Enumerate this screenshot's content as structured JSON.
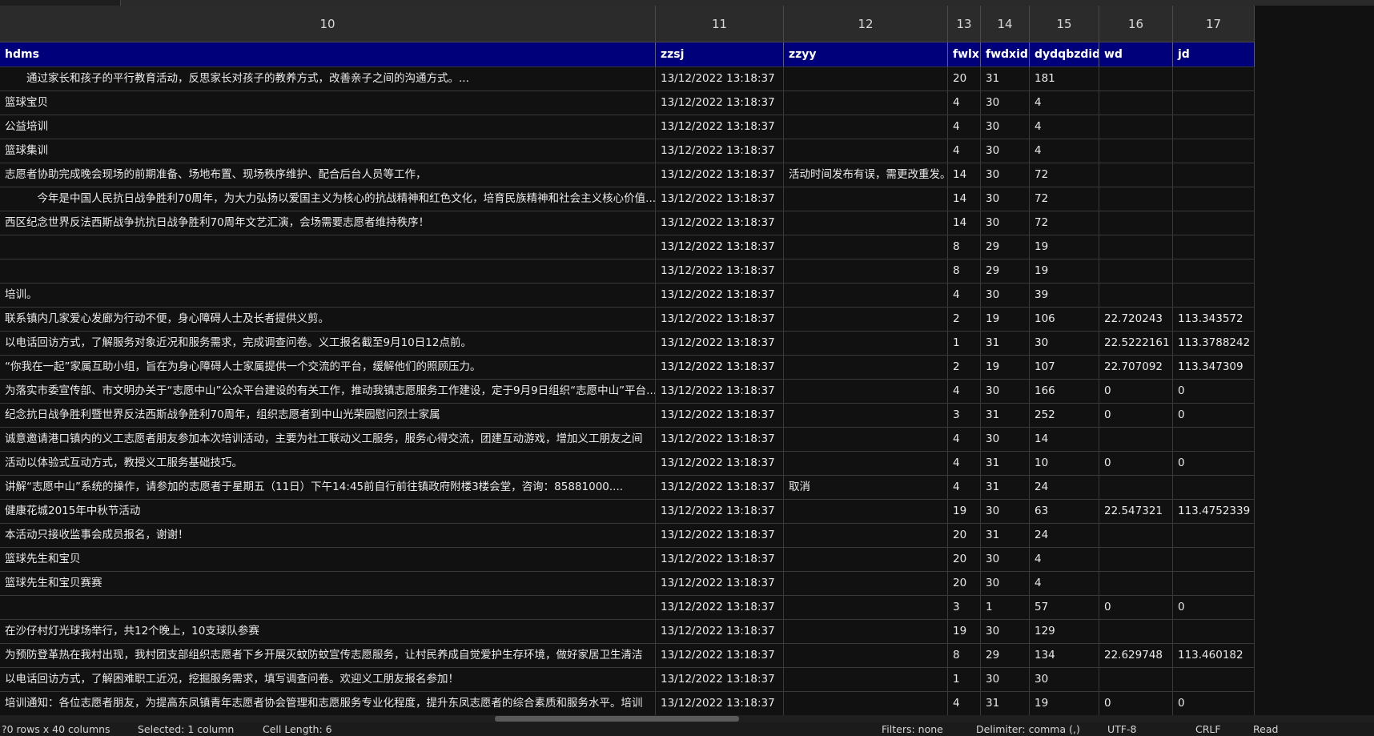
{
  "column_numbers": [
    "10",
    "11",
    "12",
    "13",
    "14",
    "15",
    "16",
    "17"
  ],
  "headers": [
    "hdms",
    "zzsj",
    "zzyy",
    "fwlx",
    "fwdxid",
    "dydqbzdid",
    "wd",
    "jd"
  ],
  "rows": [
    [
      "　　通过家长和孩子的平行教育活动，反思家长对孩子的教养方式，改善亲子之间的沟通方式。...",
      "13/12/2022 13:18:37",
      "",
      "20",
      "31",
      "181",
      "",
      ""
    ],
    [
      "篮球宝贝",
      "13/12/2022 13:18:37",
      "",
      "4",
      "30",
      "4",
      "",
      ""
    ],
    [
      "公益培训",
      "13/12/2022 13:18:37",
      "",
      "4",
      "30",
      "4",
      "",
      ""
    ],
    [
      "篮球集训",
      "13/12/2022 13:18:37",
      "",
      "4",
      "30",
      "4",
      "",
      ""
    ],
    [
      "志愿者协助完成晚会现场的前期准备、场地布置、现场秩序维护、配合后台人员等工作，",
      "13/12/2022 13:18:37",
      "活动时间发布有误，需更改重发。",
      "14",
      "30",
      "72",
      "",
      ""
    ],
    [
      "　　　今年是中国人民抗日战争胜利70周年，为大力弘扬以爱国主义为核心的抗战精神和红色文化，培育民族精神和社会主义核心价值...",
      "13/12/2022 13:18:37",
      "",
      "14",
      "30",
      "72",
      "",
      ""
    ],
    [
      "西区纪念世界反法西斯战争抗抗日战争胜利70周年文艺汇演，会场需要志愿者维持秩序！",
      "13/12/2022 13:18:37",
      "",
      "14",
      "30",
      "72",
      "",
      ""
    ],
    [
      "",
      "13/12/2022 13:18:37",
      "",
      "8",
      "29",
      "19",
      "",
      ""
    ],
    [
      "",
      "13/12/2022 13:18:37",
      "",
      "8",
      "29",
      "19",
      "",
      ""
    ],
    [
      "培训。",
      "13/12/2022 13:18:37",
      "",
      "4",
      "30",
      "39",
      "",
      ""
    ],
    [
      "联系镇内几家爱心发廊为行动不便，身心障碍人士及长者提供义剪。",
      "13/12/2022 13:18:37",
      "",
      "2",
      "19",
      "106",
      "22.720243",
      "113.343572"
    ],
    [
      "以电话回访方式，了解服务对象近况和服务需求，完成调查问卷。义工报名截至9月10日12点前。",
      "13/12/2022 13:18:37",
      "",
      "1",
      "31",
      "30",
      "22.5222161",
      "113.3788242"
    ],
    [
      "“你我在一起”家属互助小组，旨在为身心障碍人士家属提供一个交流的平台，缓解他们的照顾压力。",
      "13/12/2022 13:18:37",
      "",
      "2",
      "19",
      "107",
      "22.707092",
      "113.347309"
    ],
    [
      "为落实市委宣传部、市文明办关于“志愿中山”公众平台建设的有关工作，推动我镇志愿服务工作建设，定于9月9日组织“志愿中山”平台...",
      "13/12/2022 13:18:37",
      "",
      "4",
      "30",
      "166",
      "0",
      "0"
    ],
    [
      "纪念抗日战争胜利暨世界反法西斯战争胜利70周年，组织志愿者到中山光荣园慰问烈士家属",
      "13/12/2022 13:18:37",
      "",
      "3",
      "31",
      "252",
      "0",
      "0"
    ],
    [
      "诚意邀请港口镇内的义工志愿者朋友参加本次培训活动，主要为社工联动义工服务，服务心得交流，团建互动游戏，增加义工朋友之间",
      "13/12/2022 13:18:37",
      "",
      "4",
      "30",
      "14",
      "",
      ""
    ],
    [
      "活动以体验式互动方式，教授义工服务基础技巧。",
      "13/12/2022 13:18:37",
      "",
      "4",
      "31",
      "10",
      "0",
      "0"
    ],
    [
      "讲解“志愿中山”系统的操作，请参加的志愿者于星期五（11日）下午14:45前自行前往镇政府附楼3楼会堂，咨询：85881000....",
      "13/12/2022 13:18:37",
      "取消",
      "4",
      "31",
      "24",
      "",
      ""
    ],
    [
      "健康花城2015年中秋节活动",
      "13/12/2022 13:18:37",
      "",
      "19",
      "30",
      "63",
      "22.547321",
      "113.4752339"
    ],
    [
      "本活动只接收监事会成员报名，谢谢！",
      "13/12/2022 13:18:37",
      "",
      "20",
      "31",
      "24",
      "",
      ""
    ],
    [
      "篮球先生和宝贝",
      "13/12/2022 13:18:37",
      "",
      "20",
      "30",
      "4",
      "",
      ""
    ],
    [
      "篮球先生和宝贝赛赛",
      "13/12/2022 13:18:37",
      "",
      "20",
      "30",
      "4",
      "",
      ""
    ],
    [
      "",
      "13/12/2022 13:18:37",
      "",
      "3",
      "1",
      "57",
      "0",
      "0"
    ],
    [
      "在沙仔村灯光球场举行，共12个晚上，10支球队参赛",
      "13/12/2022 13:18:37",
      "",
      "19",
      "30",
      "129",
      "",
      ""
    ],
    [
      "为预防登革热在我村出现，我村团支部组织志愿者下乡开展灭蚊防蚊宣传志愿服务，让村民养成自觉爱护生存环境，做好家居卫生清洁",
      "13/12/2022 13:18:37",
      "",
      "8",
      "29",
      "134",
      "22.629748",
      "113.460182"
    ],
    [
      "以电话回访方式，了解困难职工近况，挖掘服务需求，填写调查问卷。欢迎义工朋友报名参加！",
      "13/12/2022 13:18:37",
      "",
      "1",
      "30",
      "30",
      "",
      ""
    ],
    [
      "培训通知：各位志愿者朋友，为提高东凤镇青年志愿者协会管理和志愿服务专业化程度，提升东凤志愿者的综合素质和服务水平。培训",
      "13/12/2022 13:18:37",
      "",
      "4",
      "31",
      "19",
      "0",
      "0"
    ]
  ],
  "status": {
    "rows_cols": "?0 rows x 40 columns",
    "selected": "Selected: 1 column",
    "cell_length": "Cell Length: 6",
    "filters": "Filters: none",
    "delimiter": "Delimiter: comma (,)",
    "encoding": "UTF-8",
    "line_ending": "CRLF",
    "mode": "Read"
  },
  "colors": {
    "header_bg": "#00007a",
    "grid_bg": "#111111"
  }
}
